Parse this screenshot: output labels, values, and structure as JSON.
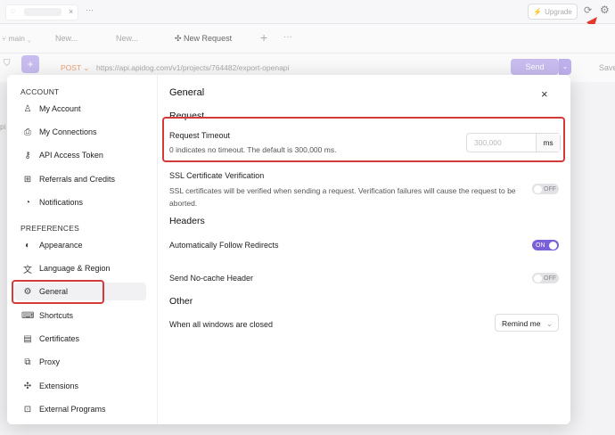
{
  "topbar": {
    "upgrade_label": "Upgrade"
  },
  "tabs": {
    "branch": "main",
    "tab1": "New...",
    "tab2": "New...",
    "tab3": "New Request",
    "add": "+",
    "more": "···"
  },
  "request": {
    "method": "POST",
    "url": "https://api.apidog.com/v1/projects/764482/export-openapi",
    "send": "Send",
    "save": "Save"
  },
  "modal": {
    "close": "×",
    "account_section": "ACCOUNT",
    "account_items": [
      "My Account",
      "My Connections",
      "API Access Token",
      "Referrals and Credits",
      "Notifications"
    ],
    "preferences_section": "PREFERENCES",
    "preference_items": [
      "Appearance",
      "Language & Region",
      "General",
      "Shortcuts",
      "Certificates",
      "Proxy",
      "Extensions",
      "External Programs"
    ],
    "title": "General",
    "request_heading": "Request",
    "timeout_label": "Request Timeout",
    "timeout_desc": "0 indicates no timeout. The default is 300,000 ms.",
    "timeout_placeholder": "300,000",
    "timeout_unit": "ms",
    "ssl_label": "SSL Certificate Verification",
    "ssl_desc": "SSL certificates will be verified when sending a request. Verification failures will cause the request to be aborted.",
    "ssl_toggle": "OFF",
    "headers_heading": "Headers",
    "redirect_label": "Automatically Follow Redirects",
    "redirect_toggle": "ON",
    "nocache_label": "Send No-cache Header",
    "nocache_toggle": "OFF",
    "other_heading": "Other",
    "windows_label": "When all windows are closed",
    "windows_value": "Remind me"
  },
  "colors": {
    "accent": "#7b61d9",
    "highlight_red": "#d43a3a",
    "method_post": "#f0a070"
  }
}
